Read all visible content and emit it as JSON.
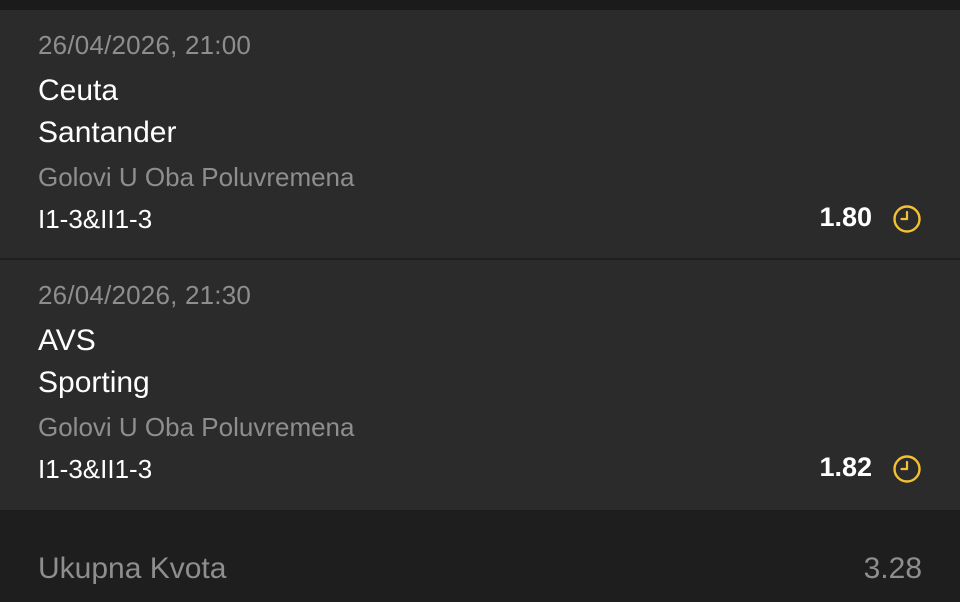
{
  "bets": [
    {
      "datetime": "26/04/2026, 21:00",
      "home_team": "Ceuta",
      "away_team": "Santander",
      "market": "Golovi U Oba Poluvremena",
      "pick": "I1-3&II1-3",
      "odds": "1.80",
      "status_icon": "clock-icon"
    },
    {
      "datetime": "26/04/2026, 21:30",
      "home_team": "AVS",
      "away_team": "Sporting",
      "market": "Golovi U Oba Poluvremena",
      "pick": "I1-3&II1-3",
      "odds": "1.82",
      "status_icon": "clock-icon"
    }
  ],
  "total": {
    "label": "Ukupna Kvota",
    "value": "3.28"
  },
  "colors": {
    "background": "#1e1e1e",
    "card": "#2b2b2b",
    "muted_text": "#8e8e8e",
    "primary_text": "#ffffff",
    "accent": "#f2c230"
  }
}
